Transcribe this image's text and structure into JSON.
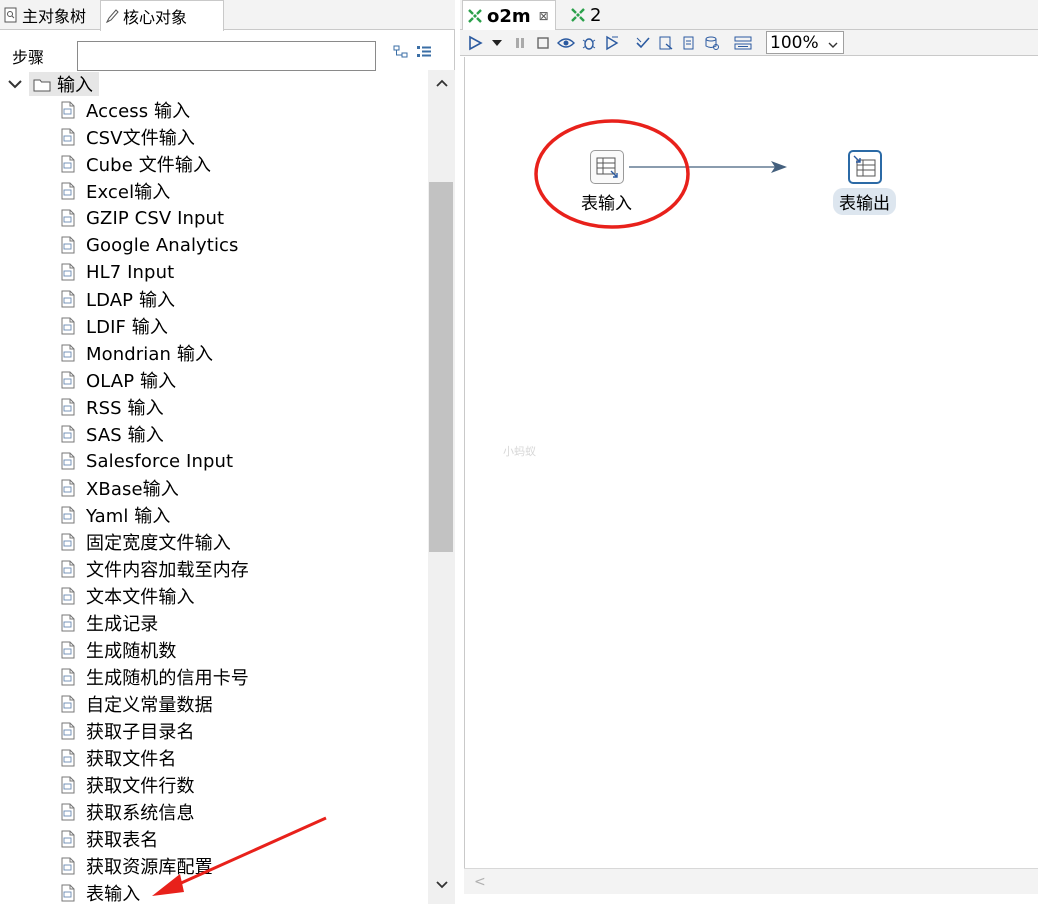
{
  "left_panel": {
    "tabs": [
      {
        "label": "主对象树",
        "icon": "object-tree-icon"
      },
      {
        "label": "核心对象",
        "icon": "core-objects-icon"
      }
    ],
    "search": {
      "label": "步骤",
      "value": ""
    },
    "tree": {
      "folder": {
        "label": "输入",
        "expanded": true
      },
      "items": [
        {
          "label": "Access 输入",
          "icon": "access-file-icon"
        },
        {
          "label": "CSV文件输入",
          "icon": "csv-file-icon"
        },
        {
          "label": "Cube 文件输入",
          "icon": "cube-file-icon"
        },
        {
          "label": "Excel输入",
          "icon": "excel-file-icon"
        },
        {
          "label": "GZIP CSV Input",
          "icon": "gzip-file-icon"
        },
        {
          "label": "Google Analytics",
          "icon": "google-analytics-icon"
        },
        {
          "label": "HL7 Input",
          "icon": "hl7-icon"
        },
        {
          "label": "LDAP 输入",
          "icon": "ldap-shield-icon"
        },
        {
          "label": "LDIF 输入",
          "icon": "ldif-shield-icon"
        },
        {
          "label": "Mondrian 输入",
          "icon": "mondrian-cube-icon"
        },
        {
          "label": "OLAP 输入",
          "icon": "olap-cube-icon"
        },
        {
          "label": "RSS 输入",
          "icon": "rss-icon"
        },
        {
          "label": "SAS 输入",
          "icon": "sas-file-icon"
        },
        {
          "label": "Salesforce Input",
          "icon": "salesforce-icon"
        },
        {
          "label": "XBase输入",
          "icon": "xbase-file-icon"
        },
        {
          "label": "Yaml 输入",
          "icon": "yaml-file-icon"
        },
        {
          "label": "固定宽度文件输入",
          "icon": "fixed-width-file-icon"
        },
        {
          "label": "文件内容加载至内存",
          "icon": "load-file-icon"
        },
        {
          "label": "文本文件输入",
          "icon": "text-file-icon"
        },
        {
          "label": "生成记录",
          "icon": "generate-rows-icon"
        },
        {
          "label": "生成随机数",
          "icon": "random-value-icon"
        },
        {
          "label": "生成随机的信用卡号",
          "icon": "random-ccn-icon"
        },
        {
          "label": "自定义常量数据",
          "icon": "data-grid-icon"
        },
        {
          "label": "获取子目录名",
          "icon": "subfolder-icon"
        },
        {
          "label": "获取文件名",
          "icon": "get-filename-icon"
        },
        {
          "label": "获取文件行数",
          "icon": "file-rows-count-icon"
        },
        {
          "label": "获取系统信息",
          "icon": "system-info-icon"
        },
        {
          "label": "获取表名",
          "icon": "table-names-icon"
        },
        {
          "label": "获取资源库配置",
          "icon": "repository-config-icon"
        },
        {
          "label": "表输入",
          "icon": "table-input-icon"
        }
      ]
    }
  },
  "right_panel": {
    "tabs": [
      {
        "label": "o2m",
        "icon": "transformation-icon",
        "active": true
      },
      {
        "label": "2",
        "icon": "transformation-icon",
        "active": false
      }
    ],
    "toolbar": {
      "zoom": "100%",
      "buttons": [
        "run-icon",
        "run-dropdown-icon",
        "pause-icon",
        "stop-icon",
        "preview-icon",
        "debug-icon",
        "replay-icon",
        "check-icon",
        "impact-icon",
        "sql-icon",
        "explore-db-icon",
        "show-results-icon"
      ]
    },
    "canvas": {
      "steps": [
        {
          "label": "表输入",
          "icon": "table-input-icon"
        },
        {
          "label": "表输出",
          "icon": "table-output-icon"
        }
      ],
      "watermark": "小蚂蚁"
    }
  }
}
